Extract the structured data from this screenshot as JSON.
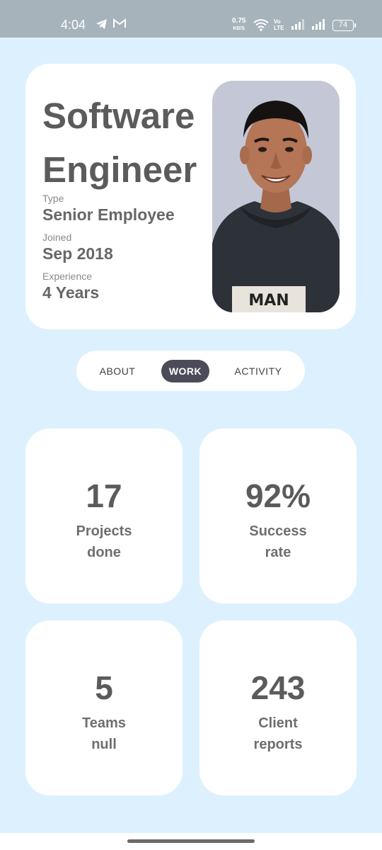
{
  "status_bar": {
    "time": "4:04",
    "speed_value": "0.75",
    "speed_unit": "KB/S",
    "volte_top": "Vo",
    "volte_bottom": "LTE",
    "battery": "74",
    "icons": [
      "telegram-icon",
      "gmail-icon",
      "wifi-icon",
      "signal-icon",
      "signal-icon",
      "battery-icon"
    ]
  },
  "profile": {
    "title_line1": "Software",
    "title_line2": "Engineer",
    "type_label": "Type",
    "type_value": "Senior Employee",
    "joined_label": "Joined",
    "joined_value": "Sep 2018",
    "experience_label": "Experience",
    "experience_value": "4 Years",
    "photo_shirt_text": "MAN"
  },
  "tabs": {
    "items": [
      {
        "label": "ABOUT"
      },
      {
        "label": "WORK"
      },
      {
        "label": "ACTIVITY"
      }
    ],
    "selected": "WORK"
  },
  "stats": [
    {
      "value": "17",
      "label_line1": "Projects",
      "label_line2": "done"
    },
    {
      "value": "92%",
      "label_line1": "Success",
      "label_line2": "rate"
    },
    {
      "value": "5",
      "label_line1": "Teams",
      "label_line2": "null"
    },
    {
      "value": "243",
      "label_line1": "Client",
      "label_line2": "reports"
    }
  ],
  "colors": {
    "background": "#ddf0fd",
    "card": "#ffffff",
    "status_bar": "#a6b3bb",
    "selected_tab": "#4c4b59",
    "text_dark": "#5b5b5b"
  }
}
